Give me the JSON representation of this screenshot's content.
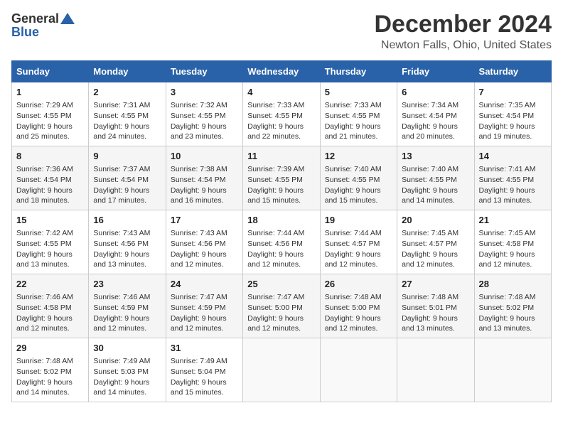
{
  "header": {
    "logo_general": "General",
    "logo_blue": "Blue",
    "month": "December 2024",
    "location": "Newton Falls, Ohio, United States"
  },
  "days_of_week": [
    "Sunday",
    "Monday",
    "Tuesday",
    "Wednesday",
    "Thursday",
    "Friday",
    "Saturday"
  ],
  "weeks": [
    [
      {
        "day": "1",
        "sunrise": "Sunrise: 7:29 AM",
        "sunset": "Sunset: 4:55 PM",
        "daylight": "Daylight: 9 hours and 25 minutes."
      },
      {
        "day": "2",
        "sunrise": "Sunrise: 7:31 AM",
        "sunset": "Sunset: 4:55 PM",
        "daylight": "Daylight: 9 hours and 24 minutes."
      },
      {
        "day": "3",
        "sunrise": "Sunrise: 7:32 AM",
        "sunset": "Sunset: 4:55 PM",
        "daylight": "Daylight: 9 hours and 23 minutes."
      },
      {
        "day": "4",
        "sunrise": "Sunrise: 7:33 AM",
        "sunset": "Sunset: 4:55 PM",
        "daylight": "Daylight: 9 hours and 22 minutes."
      },
      {
        "day": "5",
        "sunrise": "Sunrise: 7:33 AM",
        "sunset": "Sunset: 4:55 PM",
        "daylight": "Daylight: 9 hours and 21 minutes."
      },
      {
        "day": "6",
        "sunrise": "Sunrise: 7:34 AM",
        "sunset": "Sunset: 4:54 PM",
        "daylight": "Daylight: 9 hours and 20 minutes."
      },
      {
        "day": "7",
        "sunrise": "Sunrise: 7:35 AM",
        "sunset": "Sunset: 4:54 PM",
        "daylight": "Daylight: 9 hours and 19 minutes."
      }
    ],
    [
      {
        "day": "8",
        "sunrise": "Sunrise: 7:36 AM",
        "sunset": "Sunset: 4:54 PM",
        "daylight": "Daylight: 9 hours and 18 minutes."
      },
      {
        "day": "9",
        "sunrise": "Sunrise: 7:37 AM",
        "sunset": "Sunset: 4:54 PM",
        "daylight": "Daylight: 9 hours and 17 minutes."
      },
      {
        "day": "10",
        "sunrise": "Sunrise: 7:38 AM",
        "sunset": "Sunset: 4:54 PM",
        "daylight": "Daylight: 9 hours and 16 minutes."
      },
      {
        "day": "11",
        "sunrise": "Sunrise: 7:39 AM",
        "sunset": "Sunset: 4:55 PM",
        "daylight": "Daylight: 9 hours and 15 minutes."
      },
      {
        "day": "12",
        "sunrise": "Sunrise: 7:40 AM",
        "sunset": "Sunset: 4:55 PM",
        "daylight": "Daylight: 9 hours and 15 minutes."
      },
      {
        "day": "13",
        "sunrise": "Sunrise: 7:40 AM",
        "sunset": "Sunset: 4:55 PM",
        "daylight": "Daylight: 9 hours and 14 minutes."
      },
      {
        "day": "14",
        "sunrise": "Sunrise: 7:41 AM",
        "sunset": "Sunset: 4:55 PM",
        "daylight": "Daylight: 9 hours and 13 minutes."
      }
    ],
    [
      {
        "day": "15",
        "sunrise": "Sunrise: 7:42 AM",
        "sunset": "Sunset: 4:55 PM",
        "daylight": "Daylight: 9 hours and 13 minutes."
      },
      {
        "day": "16",
        "sunrise": "Sunrise: 7:43 AM",
        "sunset": "Sunset: 4:56 PM",
        "daylight": "Daylight: 9 hours and 13 minutes."
      },
      {
        "day": "17",
        "sunrise": "Sunrise: 7:43 AM",
        "sunset": "Sunset: 4:56 PM",
        "daylight": "Daylight: 9 hours and 12 minutes."
      },
      {
        "day": "18",
        "sunrise": "Sunrise: 7:44 AM",
        "sunset": "Sunset: 4:56 PM",
        "daylight": "Daylight: 9 hours and 12 minutes."
      },
      {
        "day": "19",
        "sunrise": "Sunrise: 7:44 AM",
        "sunset": "Sunset: 4:57 PM",
        "daylight": "Daylight: 9 hours and 12 minutes."
      },
      {
        "day": "20",
        "sunrise": "Sunrise: 7:45 AM",
        "sunset": "Sunset: 4:57 PM",
        "daylight": "Daylight: 9 hours and 12 minutes."
      },
      {
        "day": "21",
        "sunrise": "Sunrise: 7:45 AM",
        "sunset": "Sunset: 4:58 PM",
        "daylight": "Daylight: 9 hours and 12 minutes."
      }
    ],
    [
      {
        "day": "22",
        "sunrise": "Sunrise: 7:46 AM",
        "sunset": "Sunset: 4:58 PM",
        "daylight": "Daylight: 9 hours and 12 minutes."
      },
      {
        "day": "23",
        "sunrise": "Sunrise: 7:46 AM",
        "sunset": "Sunset: 4:59 PM",
        "daylight": "Daylight: 9 hours and 12 minutes."
      },
      {
        "day": "24",
        "sunrise": "Sunrise: 7:47 AM",
        "sunset": "Sunset: 4:59 PM",
        "daylight": "Daylight: 9 hours and 12 minutes."
      },
      {
        "day": "25",
        "sunrise": "Sunrise: 7:47 AM",
        "sunset": "Sunset: 5:00 PM",
        "daylight": "Daylight: 9 hours and 12 minutes."
      },
      {
        "day": "26",
        "sunrise": "Sunrise: 7:48 AM",
        "sunset": "Sunset: 5:00 PM",
        "daylight": "Daylight: 9 hours and 12 minutes."
      },
      {
        "day": "27",
        "sunrise": "Sunrise: 7:48 AM",
        "sunset": "Sunset: 5:01 PM",
        "daylight": "Daylight: 9 hours and 13 minutes."
      },
      {
        "day": "28",
        "sunrise": "Sunrise: 7:48 AM",
        "sunset": "Sunset: 5:02 PM",
        "daylight": "Daylight: 9 hours and 13 minutes."
      }
    ],
    [
      {
        "day": "29",
        "sunrise": "Sunrise: 7:48 AM",
        "sunset": "Sunset: 5:02 PM",
        "daylight": "Daylight: 9 hours and 14 minutes."
      },
      {
        "day": "30",
        "sunrise": "Sunrise: 7:49 AM",
        "sunset": "Sunset: 5:03 PM",
        "daylight": "Daylight: 9 hours and 14 minutes."
      },
      {
        "day": "31",
        "sunrise": "Sunrise: 7:49 AM",
        "sunset": "Sunset: 5:04 PM",
        "daylight": "Daylight: 9 hours and 15 minutes."
      },
      null,
      null,
      null,
      null
    ]
  ]
}
